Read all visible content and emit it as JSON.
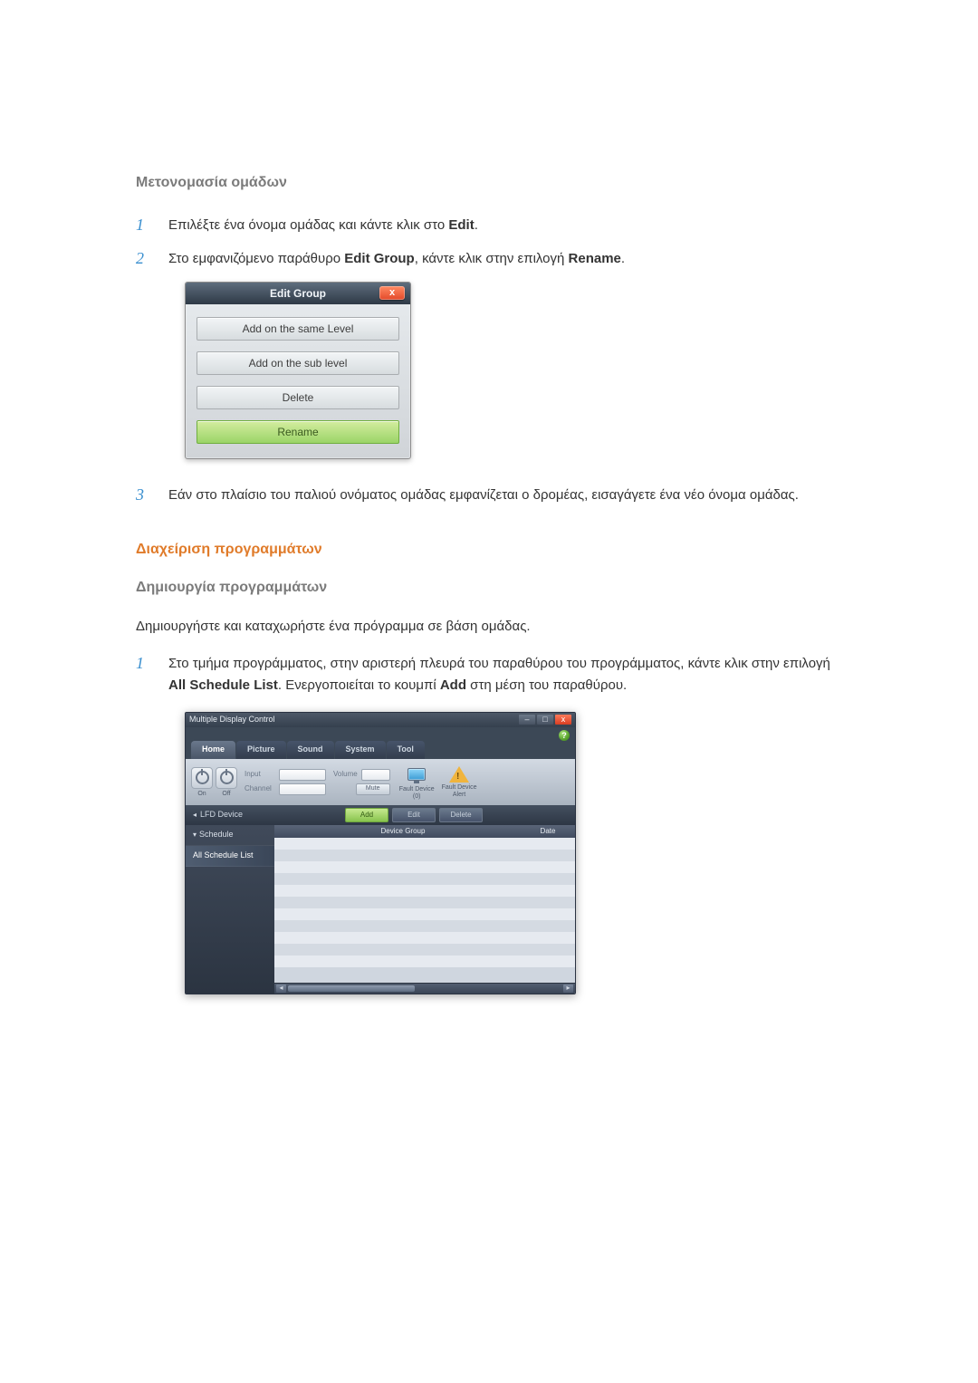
{
  "section": {
    "title_rename": "Μετονομασία ομάδων",
    "steps_rename": [
      {
        "num": "1",
        "text_a": "Επιλέξτε ένα όνομα ομάδας και κάντε κλικ στο ",
        "bold_a": "Edit",
        "text_b": "."
      },
      {
        "num": "2",
        "text_a": "Στο εμφανιζόμενο παράθυρο ",
        "bold_a": "Edit Group",
        "text_b": ", κάντε κλικ στην επιλογή ",
        "bold_b": "Rename",
        "text_c": "."
      },
      {
        "num": "3",
        "text_a": "Εάν στο πλαίσιο του παλιού ονόματος ομάδας εμφανίζεται ο δρομέας, εισαγάγετε ένα νέο όνομα ομάδας."
      }
    ],
    "title_sched_mgmt": "Διαχείριση προγραμμάτων",
    "title_sched_create": "Δημιουργία προγραμμάτων",
    "sched_intro": "Δημιουργήστε και καταχωρήστε ένα πρόγραμμα σε βάση ομάδας.",
    "steps_sched": [
      {
        "num": "1",
        "text_a": "Στο τμήμα προγράμματος, στην αριστερή πλευρά του παραθύρου του προγράμματος, κάντε κλικ στην επιλογή ",
        "bold_a": "All Schedule List",
        "text_b": ". Ενεργοποιείται το κουμπί ",
        "bold_b": "Add",
        "text_c": " στη μέση του παραθύρου."
      }
    ]
  },
  "edit_group": {
    "title": "Edit Group",
    "btns": {
      "same": "Add on the same Level",
      "sub": "Add on the sub level",
      "del": "Delete",
      "rename": "Rename"
    }
  },
  "mdc": {
    "chrome_title": "Multiple Display Control",
    "tabs": [
      "Home",
      "Picture",
      "Sound",
      "System",
      "Tool"
    ],
    "toolbar": {
      "on": "On",
      "off": "Off",
      "input": "Input",
      "channel": "Channel",
      "volume": "Volume",
      "mute": "Mute",
      "fault0": "Fault Device",
      "fault0_n": "(0)",
      "alert": "Fault Device",
      "alert2": "Alert"
    },
    "strip": {
      "lfd": "LFD Device",
      "add": "Add",
      "edit": "Edit",
      "delete": "Delete"
    },
    "side": {
      "schedule": "Schedule",
      "all_list": "All Schedule List"
    },
    "grid": {
      "col1": "Device Group",
      "col2": "Date"
    }
  }
}
